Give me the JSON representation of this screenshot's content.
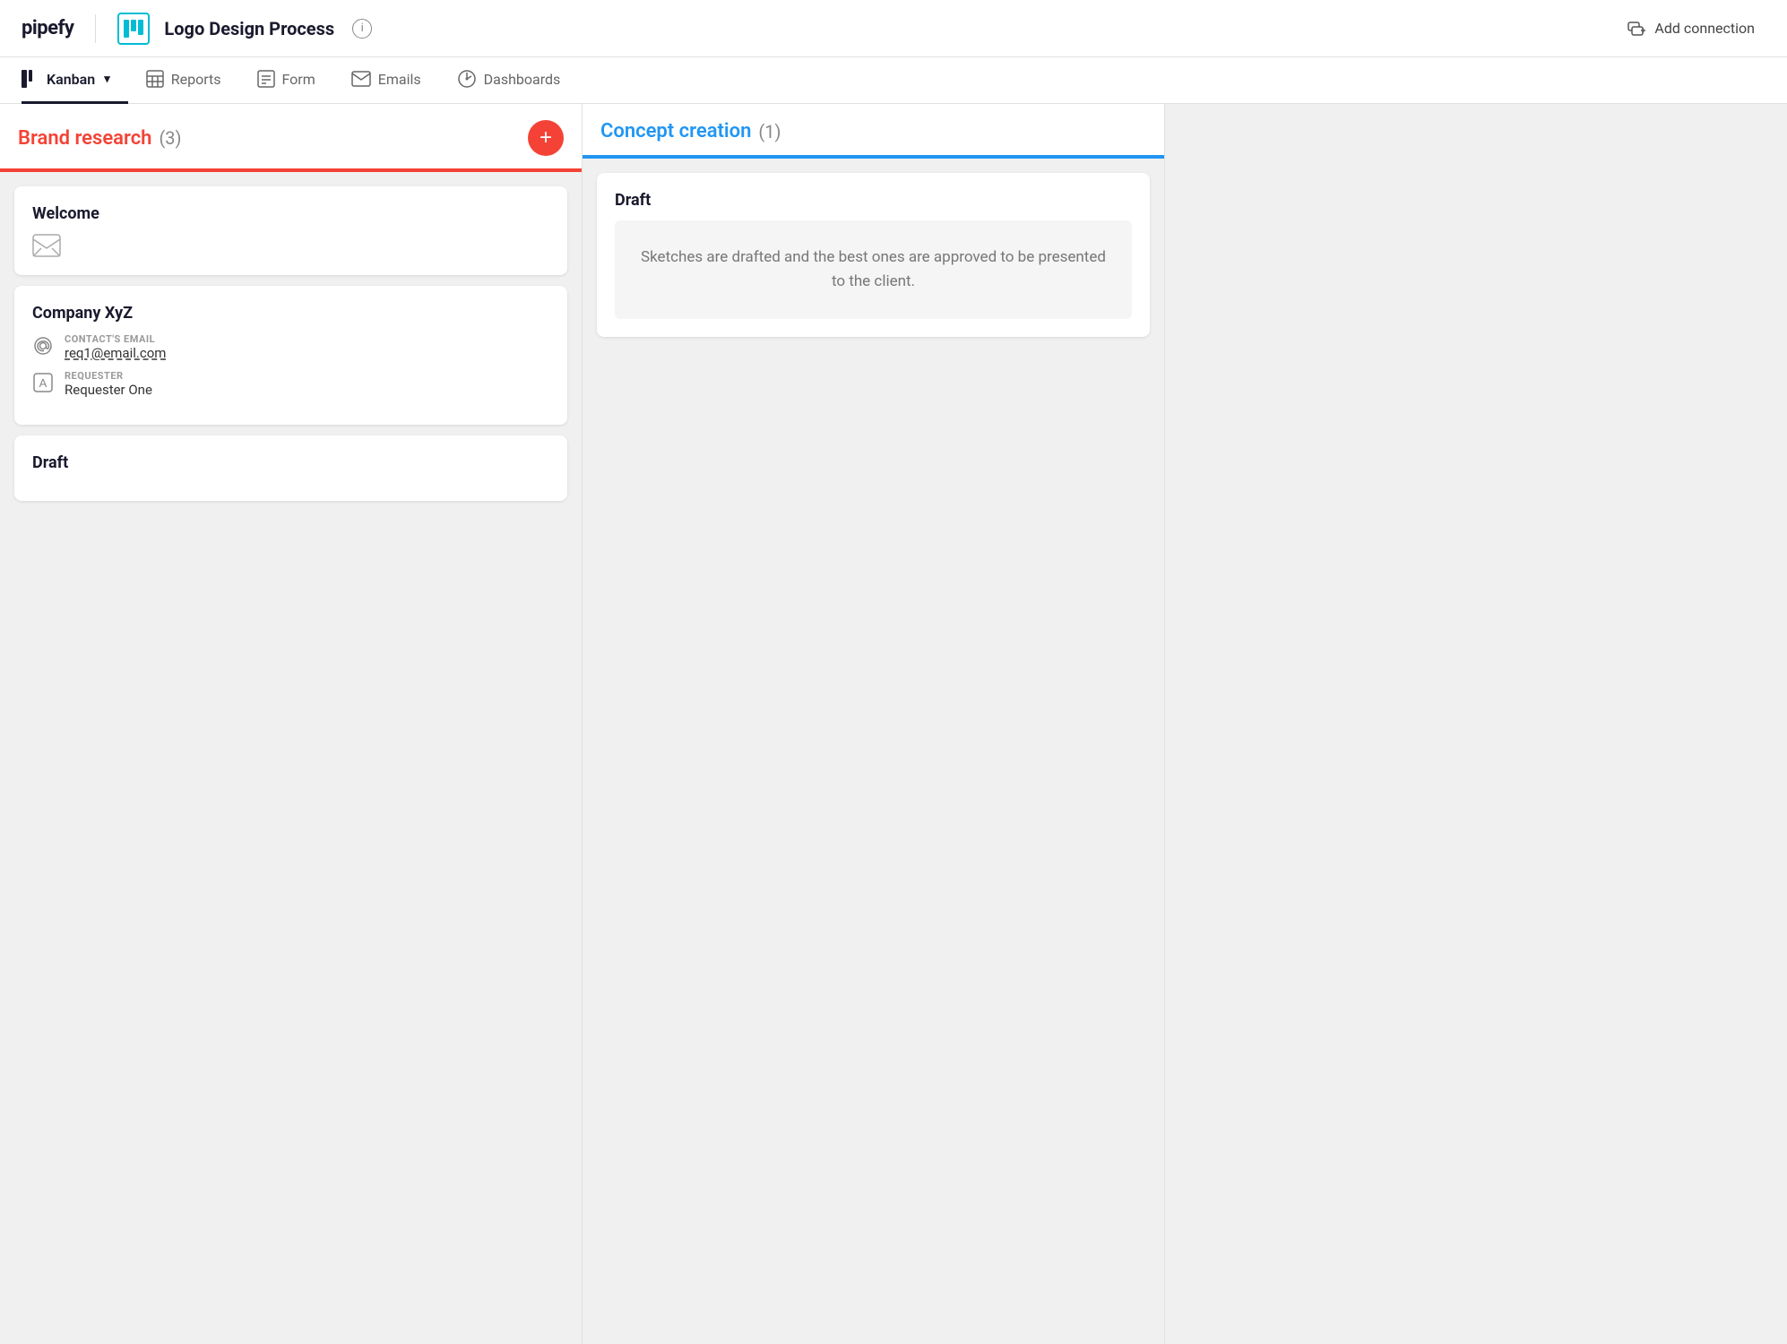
{
  "app": {
    "logo": "pipefy",
    "pipe_icon_chars": "|||",
    "pipe_title": "Logo Design Process",
    "info_icon": "i",
    "add_connection_label": "Add connection"
  },
  "tabs": [
    {
      "id": "kanban",
      "label": "Kanban",
      "icon": "kanban-icon",
      "active": true,
      "has_chevron": true
    },
    {
      "id": "reports",
      "label": "Reports",
      "icon": "reports-icon",
      "active": false
    },
    {
      "id": "form",
      "label": "Form",
      "icon": "form-icon",
      "active": false
    },
    {
      "id": "emails",
      "label": "Emails",
      "icon": "emails-icon",
      "active": false
    },
    {
      "id": "dashboards",
      "label": "Dashboards",
      "icon": "dashboards-icon",
      "active": false
    }
  ],
  "columns": [
    {
      "id": "brand-research",
      "title": "Brand research",
      "count": "(3)",
      "accent": "red",
      "has_add_button": true,
      "cards": [
        {
          "id": "welcome",
          "title": "Welcome",
          "has_envelope": true,
          "fields": []
        },
        {
          "id": "company-xyz",
          "title": "Company XyZ",
          "has_envelope": false,
          "fields": [
            {
              "icon": "at-icon",
              "label": "CONTACT'S EMAIL",
              "value": "req1@email.com",
              "underline": true
            },
            {
              "icon": "person-icon",
              "label": "REQUESTER",
              "value": "Requester One",
              "underline": false
            }
          ]
        },
        {
          "id": "draft-brand",
          "title": "Draft",
          "has_envelope": false,
          "fields": []
        }
      ]
    },
    {
      "id": "concept-creation",
      "title": "Concept creation",
      "count": "(1)",
      "accent": "blue",
      "has_add_button": false,
      "cards": [
        {
          "id": "draft-concept",
          "title": "Draft",
          "description": "Sketches are drafted and the best ones are approved to be presented to the client."
        }
      ]
    }
  ]
}
